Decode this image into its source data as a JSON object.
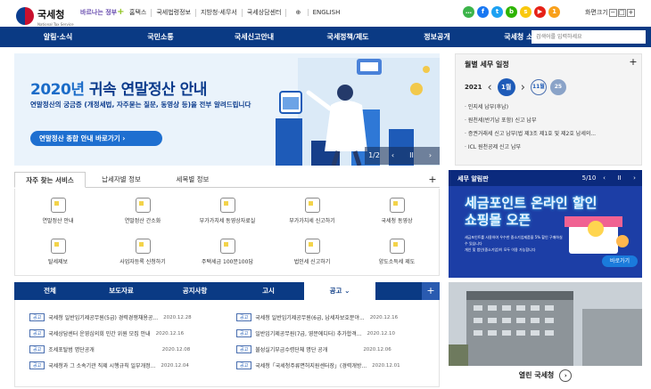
{
  "header": {
    "logo_title": "국세청",
    "logo_sub": "National Tax Service",
    "slogan": "바르나는 정부",
    "links": [
      "홈택스",
      "국세법령정보",
      "지방청·세무서",
      "국세상담센터",
      "ENGLISH"
    ],
    "sns_icons": [
      "kakaotalk-icon",
      "facebook-icon",
      "twitter-icon",
      "blog-icon",
      "kakaostory-icon",
      "youtube-icon"
    ],
    "notification_count": "1",
    "screen_size_label": "화면크기"
  },
  "nav": {
    "items": [
      "알림·소식",
      "국민소통",
      "국세신고안내",
      "국세정책/제도",
      "정보공개",
      "국세청 소개"
    ],
    "search_placeholder": "검색어를 입력하세요"
  },
  "hero": {
    "title_year": "2020년",
    "title_rest": " 귀속 연말정산 안내",
    "desc": "연말정산의 궁금증 (개정세법, 자주묻는 질문, 동영상 등)을 전부 알려드립니다",
    "button": "연말정산 종합 안내 바로가기",
    "page": "1/2"
  },
  "schedule": {
    "title": "월별 세무 일정",
    "year": "2021",
    "months": [
      "1월",
      "11월",
      "25"
    ],
    "items": [
      "· 인지세 납부(후납)",
      "· 원천세(반기납 포함) 신고 납부",
      "· 증권거래세 신고 납부(법 제3조 제1호 및 제2호 납세의...",
      "· ICL 원천공제 신고 납부"
    ]
  },
  "service_tabs": [
    "자주 찾는 서비스",
    "납세자별 정보",
    "세목별 정보"
  ],
  "services": [
    {
      "label": "연말정산 안내",
      "icon": "calculator-icon"
    },
    {
      "label": "연말정산 간소화",
      "icon": "document-icon"
    },
    {
      "label": "부가가치세 동영상자료실",
      "icon": "video-icon"
    },
    {
      "label": "부가가치세 신고하기",
      "icon": "hand-coin-icon"
    },
    {
      "label": "국세청 동영상",
      "icon": "person-icon"
    },
    {
      "label": "탈세제보",
      "icon": "report-icon"
    },
    {
      "label": "사업자등록 신청하기",
      "icon": "register-icon"
    },
    {
      "label": "주택세금 100문100답",
      "icon": "book-icon"
    },
    {
      "label": "법인세 신고하기",
      "icon": "pen-icon"
    },
    {
      "label": "양도소득세 제도",
      "icon": "list-icon"
    }
  ],
  "banner2": {
    "title": "세무 알림판",
    "page": "5/10",
    "headline1": "세금포인트 온라인 할인",
    "headline2": "쇼핑몰 오픈",
    "sub": "세금포인트를 사용하여 우수한 중소기업제품을 5% 할인 구매하실 수 있습니다",
    "sub2": "개인 및 법인(중소기업)이 모두 이용 가능합니다",
    "button": "바로가기"
  },
  "news_tabs": [
    "전체",
    "보도자료",
    "공지사항",
    "고시",
    "공고"
  ],
  "news": [
    {
      "badge": "공고",
      "title": "국세청 일반임기제공무원(5급) 경력경쟁채용공...",
      "date": "2020.12.28"
    },
    {
      "badge": "공고",
      "title": "국세청 일반임기제공무원(6급, 납세자보호분야...",
      "date": "2020.12.16"
    },
    {
      "badge": "공고",
      "title": "국세상담센터 운영심의회 민간 위원 모집 안내",
      "date": "2020.12.16"
    },
    {
      "badge": "공고",
      "title": "일반임기제공무원(7급, 영문에디터) 추가합격...",
      "date": "2020.12.10"
    },
    {
      "badge": "공고",
      "title": "조세포탈범 명단공개",
      "date": "2020.12.08"
    },
    {
      "badge": "공고",
      "title": "불성실기부금수령단체 명단 공개",
      "date": "2020.12.06"
    },
    {
      "badge": "공고",
      "title": "국세청과 그 소속기관 직제 시행규칙 일부개정...",
      "date": "2020.12.04"
    },
    {
      "badge": "공고",
      "title": "국세청「국세청주류면허지원센터장」(경력개방...",
      "date": "2020.12.01"
    }
  ],
  "open_panel": {
    "label": "열린 국세청"
  },
  "colors": {
    "nav": "#0a3a84",
    "accent": "#1e6fd0"
  }
}
